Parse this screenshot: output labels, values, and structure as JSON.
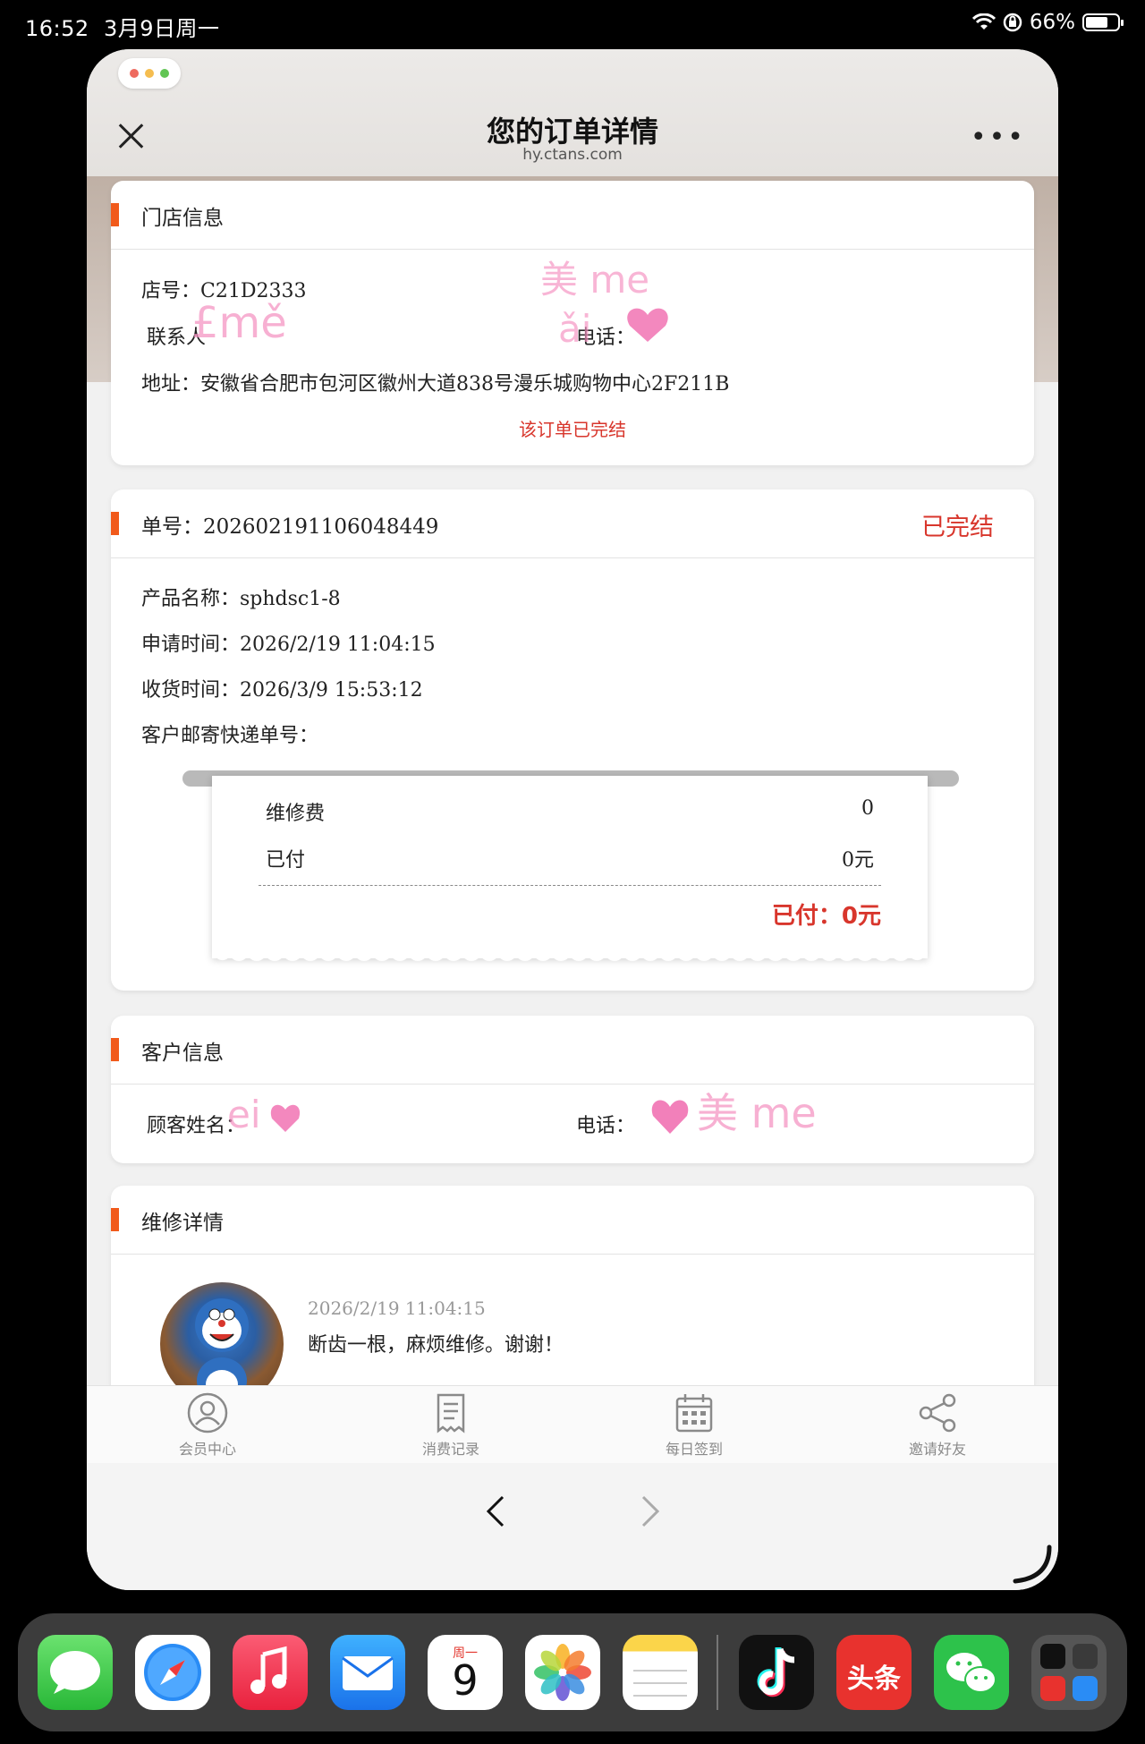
{
  "status_bar": {
    "time": "16:52",
    "date": "3月9日周一",
    "battery_pct": "66%"
  },
  "window": {
    "title": "您的订单详情",
    "url": "hy.ctans.com",
    "close_icon": "close-icon",
    "more_icon": "more-icon"
  },
  "store_card": {
    "header": "门店信息",
    "store_no_label": "店号：",
    "store_no": "C21D2333",
    "contact_label": "联系人",
    "phone_label": "电话：",
    "address_label": "地址：",
    "address": "安徽省合肥市包河区徽州大道838号漫乐城购物中心2F211B",
    "notice": "该订单已完结"
  },
  "order_card": {
    "order_no_label": "单号：",
    "order_no": "202602191106048449",
    "status": "已完结",
    "product_label": "产品名称：",
    "product": "sphdsc1-8",
    "apply_time_label": "申请时间：",
    "apply_time": "2026/2/19 11:04:15",
    "receive_time_label": "收货时间：",
    "receive_time": "2026/3/9 15:53:12",
    "tracking_label": "客户邮寄快递单号：",
    "receipt": {
      "repair_fee_label": "维修费",
      "repair_fee": "0",
      "paid_label": "已付",
      "paid": "0元",
      "total_paid": "已付：0元"
    }
  },
  "customer_card": {
    "header": "客户信息",
    "name_label": "顾客姓名：",
    "phone_label": "电话："
  },
  "repair_card": {
    "header": "维修详情",
    "entry_time": "2026/2/19 11:04:15",
    "entry_text": "断齿一根，麻烦维修。谢谢！"
  },
  "tab_bar": {
    "items": [
      {
        "label": "会员中心",
        "icon": "user-icon"
      },
      {
        "label": "消费记录",
        "icon": "receipt-icon"
      },
      {
        "label": "每日签到",
        "icon": "calendar-icon"
      },
      {
        "label": "邀请好友",
        "icon": "share-icon"
      }
    ]
  },
  "dock": {
    "calendar_weekday": "周一",
    "calendar_day": "9",
    "toutiao_label": "头条",
    "apps": [
      "Messages",
      "Safari",
      "Music",
      "Mail",
      "Calendar",
      "Photos",
      "Notes",
      "TikTok",
      "Toutiao",
      "WeChat",
      "App Library"
    ]
  },
  "colors": {
    "accent_orange": "#f15a1b",
    "status_red": "#d8362c"
  }
}
